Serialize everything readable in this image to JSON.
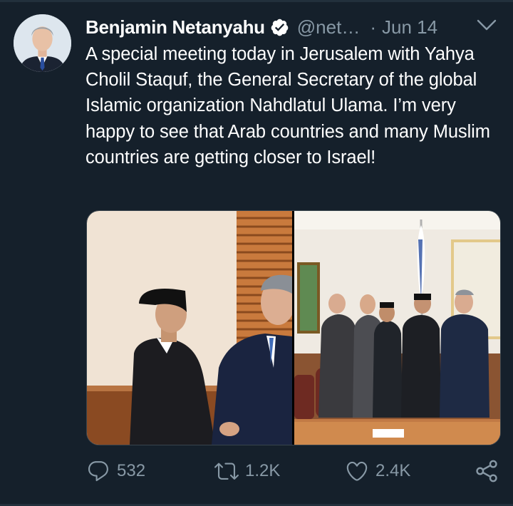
{
  "tweet": {
    "author_name": "Benjamin Netanyahu",
    "handle": "@net…",
    "separator": "·",
    "date": "Jun 14",
    "text": "A special meeting today in Jerusalem with Yahya Cholil Staquf, the General Secretary of the global Islamic organization Nahdlatul Ulama. I’m very happy to see that Arab countries and many Muslim countries are getting closer to Israel!"
  },
  "icons": {
    "avatar": "profile-photo",
    "verified": "verified-badge-icon",
    "menu": "chevron-down-icon",
    "reply": "reply-icon",
    "retweet": "retweet-icon",
    "like": "heart-icon",
    "share": "share-icon"
  },
  "actions": {
    "reply_count": "532",
    "retweet_count": "1.2K",
    "like_count": "2.4K"
  },
  "colors": {
    "background": "#15202b",
    "secondary_text": "#8899a6",
    "border": "#38444d"
  }
}
